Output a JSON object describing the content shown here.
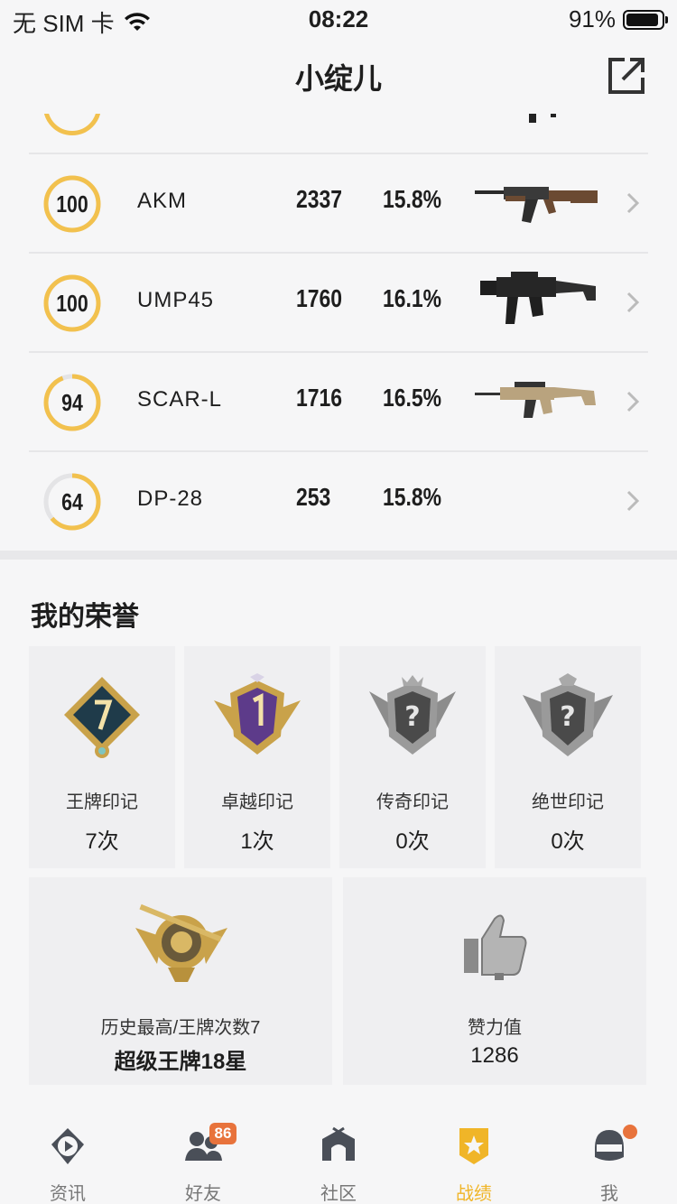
{
  "status_bar": {
    "carrier": "无 SIM 卡",
    "time": "08:22",
    "battery": "91%",
    "battery_level": 0.91
  },
  "navbar": {
    "title": "小绽儿"
  },
  "weapons": [
    {
      "name": "AKM",
      "score": "100",
      "score_pct": 100,
      "kills": "2337",
      "rate": "15.8%",
      "image": "akm-rifle"
    },
    {
      "name": "UMP45",
      "score": "100",
      "score_pct": 100,
      "kills": "1760",
      "rate": "16.1%",
      "image": "ump45-smg"
    },
    {
      "name": "SCAR-L",
      "score": "94",
      "score_pct": 94,
      "kills": "1716",
      "rate": "16.5%",
      "image": "scar-l-rifle"
    },
    {
      "name": "DP-28",
      "score": "64",
      "score_pct": 64,
      "kills": "253",
      "rate": "15.8%",
      "image": ""
    }
  ],
  "honor": {
    "title": "我的荣誉",
    "badges": [
      {
        "label": "王牌印记",
        "count": "7次",
        "icon": "ace-badge-icon"
      },
      {
        "label": "卓越印记",
        "count": "1次",
        "icon": "excellence-badge-icon"
      },
      {
        "label": "传奇印记",
        "count": "0次",
        "icon": "legend-badge-icon"
      },
      {
        "label": "绝世印记",
        "count": "0次",
        "icon": "peerless-badge-icon"
      }
    ],
    "highest": {
      "label": "历史最高/王牌次数7",
      "value": "超级王牌18星"
    },
    "likes": {
      "label": "赞力值",
      "value": "1286"
    }
  },
  "tabbar": {
    "tabs": [
      {
        "label": "资讯",
        "icon": "news-icon"
      },
      {
        "label": "好友",
        "icon": "friends-icon",
        "badge": "86"
      },
      {
        "label": "社区",
        "icon": "community-icon"
      },
      {
        "label": "战绩",
        "icon": "record-icon",
        "active": true
      },
      {
        "label": "我",
        "icon": "profile-icon",
        "dot": true
      }
    ]
  },
  "colors": {
    "accent": "#f0b528",
    "ring": "#f2c14e",
    "badge": "#e8733c"
  }
}
